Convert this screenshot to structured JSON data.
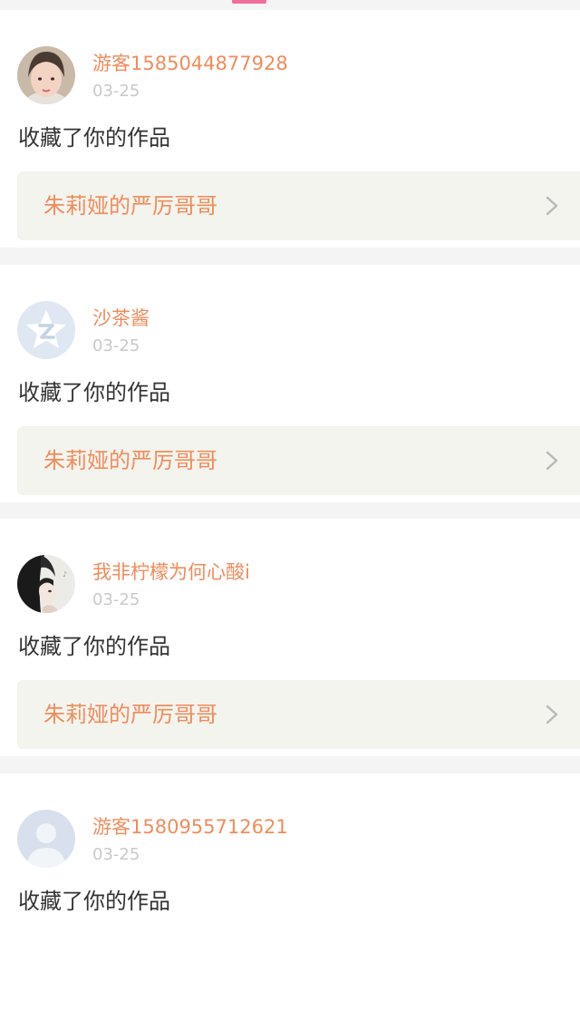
{
  "theme": {
    "accent": "#f08c5c",
    "tab_indicator": "#f06e9e",
    "date_color": "#c9c9c9",
    "text_color": "#333333",
    "card_link_bg": "#f4f4ee",
    "chevron_color": "#b8b8b8"
  },
  "notifications": [
    {
      "username": "游客1585044877928",
      "date": "03-25",
      "action": "收藏了你的作品",
      "work_title": "朱莉娅的严厉哥哥",
      "avatar_icon": "girl-photo-avatar"
    },
    {
      "username": "沙茶酱",
      "date": "03-25",
      "action": "收藏了你的作品",
      "work_title": "朱莉娅的严厉哥哥",
      "avatar_icon": "qq-logo-avatar"
    },
    {
      "username": "我非柠檬为何心酸i",
      "date": "03-25",
      "action": "收藏了你的作品",
      "work_title": "朱莉娅的严厉哥哥",
      "avatar_icon": "dark-hair-photo-avatar"
    },
    {
      "username": "游客1580955712621",
      "date": "03-25",
      "action": "收藏了你的作品",
      "work_title": "",
      "avatar_icon": "default-person-avatar"
    }
  ]
}
